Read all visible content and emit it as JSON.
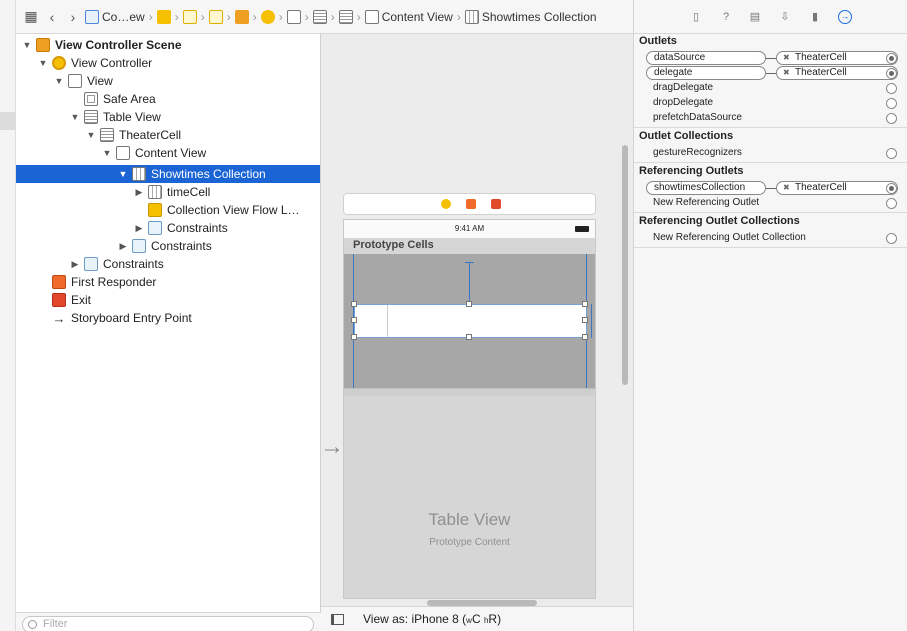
{
  "jumpbar": {
    "crumbs": [
      "Co…ew",
      "Content View",
      "Showtimes Collection"
    ]
  },
  "navigator": {
    "items": [
      {
        "label": "View Controller Scene"
      },
      {
        "label": "View Controller"
      },
      {
        "label": "View"
      },
      {
        "label": "Safe Area"
      },
      {
        "label": "Table View"
      },
      {
        "label": "TheaterCell"
      },
      {
        "label": "Content View"
      },
      {
        "label": "Showtimes Collection"
      },
      {
        "label": "timeCell"
      },
      {
        "label": "Collection View Flow L…"
      },
      {
        "label": "Constraints"
      },
      {
        "label": "Constraints"
      },
      {
        "label": "Constraints"
      },
      {
        "label": "First Responder"
      },
      {
        "label": "Exit"
      },
      {
        "label": "Storyboard Entry Point"
      }
    ],
    "filter_placeholder": "Filter"
  },
  "canvas": {
    "status_time": "9:41 AM",
    "prototype_cells": "Prototype Cells",
    "table_view_title": "Table View",
    "table_view_sub": "Prototype Content"
  },
  "bottombar": {
    "view_as": "View as: iPhone 8 (",
    "w": "w",
    "c": "C",
    "h": "h",
    "r": "R)"
  },
  "inspector": {
    "outlets_header": "Outlets",
    "outlets": [
      {
        "name": "dataSource",
        "target": "TheaterCell",
        "connected": true
      },
      {
        "name": "delegate",
        "target": "TheaterCell",
        "connected": true
      },
      {
        "name": "dragDelegate",
        "target": "",
        "connected": false
      },
      {
        "name": "dropDelegate",
        "target": "",
        "connected": false
      },
      {
        "name": "prefetchDataSource",
        "target": "",
        "connected": false
      }
    ],
    "outlet_collections_header": "Outlet Collections",
    "outlet_collections": [
      {
        "name": "gestureRecognizers"
      }
    ],
    "referencing_outlets_header": "Referencing Outlets",
    "referencing_outlets": [
      {
        "name": "showtimesCollection",
        "target": "TheaterCell",
        "connected": true
      },
      {
        "name": "New Referencing Outlet",
        "target": "",
        "connected": false
      }
    ],
    "referencing_collections_header": "Referencing Outlet Collections",
    "referencing_collections": [
      {
        "name": "New Referencing Outlet Collection"
      }
    ]
  },
  "colors": {
    "selection": "#1a64d6",
    "accent": "#1a6ee0"
  }
}
